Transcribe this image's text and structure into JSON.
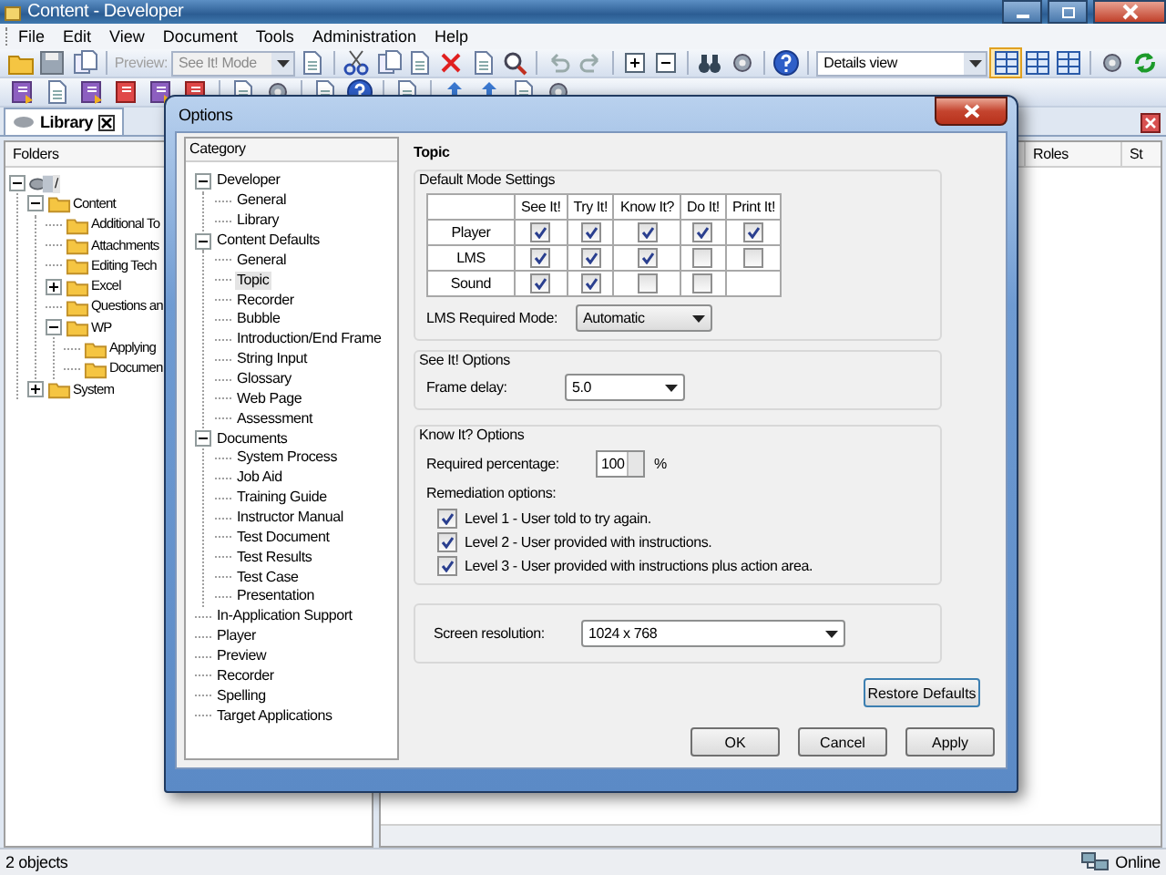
{
  "app": {
    "title": "Content - Developer"
  },
  "menu": [
    "File",
    "Edit",
    "View",
    "Document",
    "Tools",
    "Administration",
    "Help"
  ],
  "toolbar": {
    "preview": {
      "label": "Preview:",
      "mode": "See It! Mode",
      "disabled": true
    },
    "view": "Details view"
  },
  "library_tab": {
    "label": "Library"
  },
  "folders": {
    "header": "Folders",
    "tree": [
      {
        "label": "/",
        "selected": true,
        "expanded": true,
        "children": [
          {
            "label": "Content",
            "selected": false,
            "expanded": true,
            "children": [
              {
                "label": "Additional To",
                "selected": false
              },
              {
                "label": "Attachments",
                "selected": false
              },
              {
                "label": "Editing Tech",
                "selected": false
              },
              {
                "label": "Excel",
                "selected": false,
                "expanded": false
              },
              {
                "label": "Questions an",
                "selected": false
              },
              {
                "label": "WP",
                "selected": false,
                "expanded": true,
                "children": [
                  {
                    "label": "Applying",
                    "selected": false
                  },
                  {
                    "label": "Documen",
                    "selected": false
                  }
                ]
              }
            ]
          },
          {
            "label": "System",
            "selected": false,
            "expanded": false
          }
        ]
      }
    ]
  },
  "list_columns": [
    "Roles",
    "St"
  ],
  "dialog": {
    "title": "Options",
    "category_header": "Category",
    "categories": [
      {
        "label": "Developer",
        "selected": false,
        "expanded": true,
        "children": [
          {
            "label": "General",
            "selected": false
          },
          {
            "label": "Library",
            "selected": false
          }
        ]
      },
      {
        "label": "Content Defaults",
        "selected": false,
        "expanded": true,
        "children": [
          {
            "label": "General",
            "selected": false
          },
          {
            "label": "Topic",
            "selected": true
          },
          {
            "label": "Recorder",
            "selected": false
          },
          {
            "label": "Bubble",
            "selected": false
          },
          {
            "label": "Introduction/End Frame",
            "selected": false
          },
          {
            "label": "String Input",
            "selected": false
          },
          {
            "label": "Glossary",
            "selected": false
          },
          {
            "label": "Web Page",
            "selected": false
          },
          {
            "label": "Assessment",
            "selected": false
          }
        ]
      },
      {
        "label": "Documents",
        "selected": false,
        "expanded": true,
        "children": [
          {
            "label": "System Process",
            "selected": false
          },
          {
            "label": "Job Aid",
            "selected": false
          },
          {
            "label": "Training Guide",
            "selected": false
          },
          {
            "label": "Instructor Manual",
            "selected": false
          },
          {
            "label": "Test Document",
            "selected": false
          },
          {
            "label": "Test Results",
            "selected": false
          },
          {
            "label": "Test Case",
            "selected": false
          },
          {
            "label": "Presentation",
            "selected": false
          }
        ]
      },
      {
        "label": "In-Application Support",
        "selected": false
      },
      {
        "label": "Player",
        "selected": false
      },
      {
        "label": "Preview",
        "selected": false
      },
      {
        "label": "Recorder",
        "selected": false
      },
      {
        "label": "Spelling",
        "selected": false
      },
      {
        "label": "Target Applications",
        "selected": false
      }
    ],
    "heading": "Topic",
    "mode_settings": {
      "title": "Default Mode Settings",
      "columns": [
        "See It!",
        "Try It!",
        "Know It?",
        "Do It!",
        "Print It!"
      ],
      "rows": [
        {
          "label": "Player",
          "cells": [
            {
              "checked": true
            },
            {
              "checked": true
            },
            {
              "checked": true
            },
            {
              "checked": true
            },
            {
              "checked": true
            }
          ]
        },
        {
          "label": "LMS",
          "cells": [
            {
              "checked": true
            },
            {
              "checked": true
            },
            {
              "checked": true
            },
            {
              "checked": false
            },
            {
              "checked": false
            }
          ]
        },
        {
          "label": "Sound",
          "cells": [
            {
              "checked": true
            },
            {
              "checked": true
            },
            {
              "checked": false
            },
            {
              "checked": false
            }
          ]
        }
      ],
      "required_mode_label": "LMS Required Mode:",
      "required_mode": "Automatic"
    },
    "see_it": {
      "title": "See It! Options",
      "frame_delay_label": "Frame delay:",
      "frame_delay": "5.0"
    },
    "know_it": {
      "title": "Know It? Options",
      "percentage_label": "Required percentage:",
      "percentage": "100",
      "percent_sign": "%",
      "remediation_label": "Remediation options:",
      "levels": [
        {
          "label": "Level 1 - User told to try again.",
          "checked": true
        },
        {
          "label": "Level 2 - User provided with instructions.",
          "checked": true
        },
        {
          "label": "Level 3 - User provided with instructions plus action area.",
          "checked": true
        }
      ]
    },
    "resolution": {
      "label": "Screen resolution:",
      "value": "1024 x 768"
    },
    "buttons": {
      "restore": "Restore Defaults",
      "ok": "OK",
      "cancel": "Cancel",
      "apply": "Apply"
    }
  },
  "status_bar": {
    "count": "2 objects",
    "connection": "Online"
  }
}
